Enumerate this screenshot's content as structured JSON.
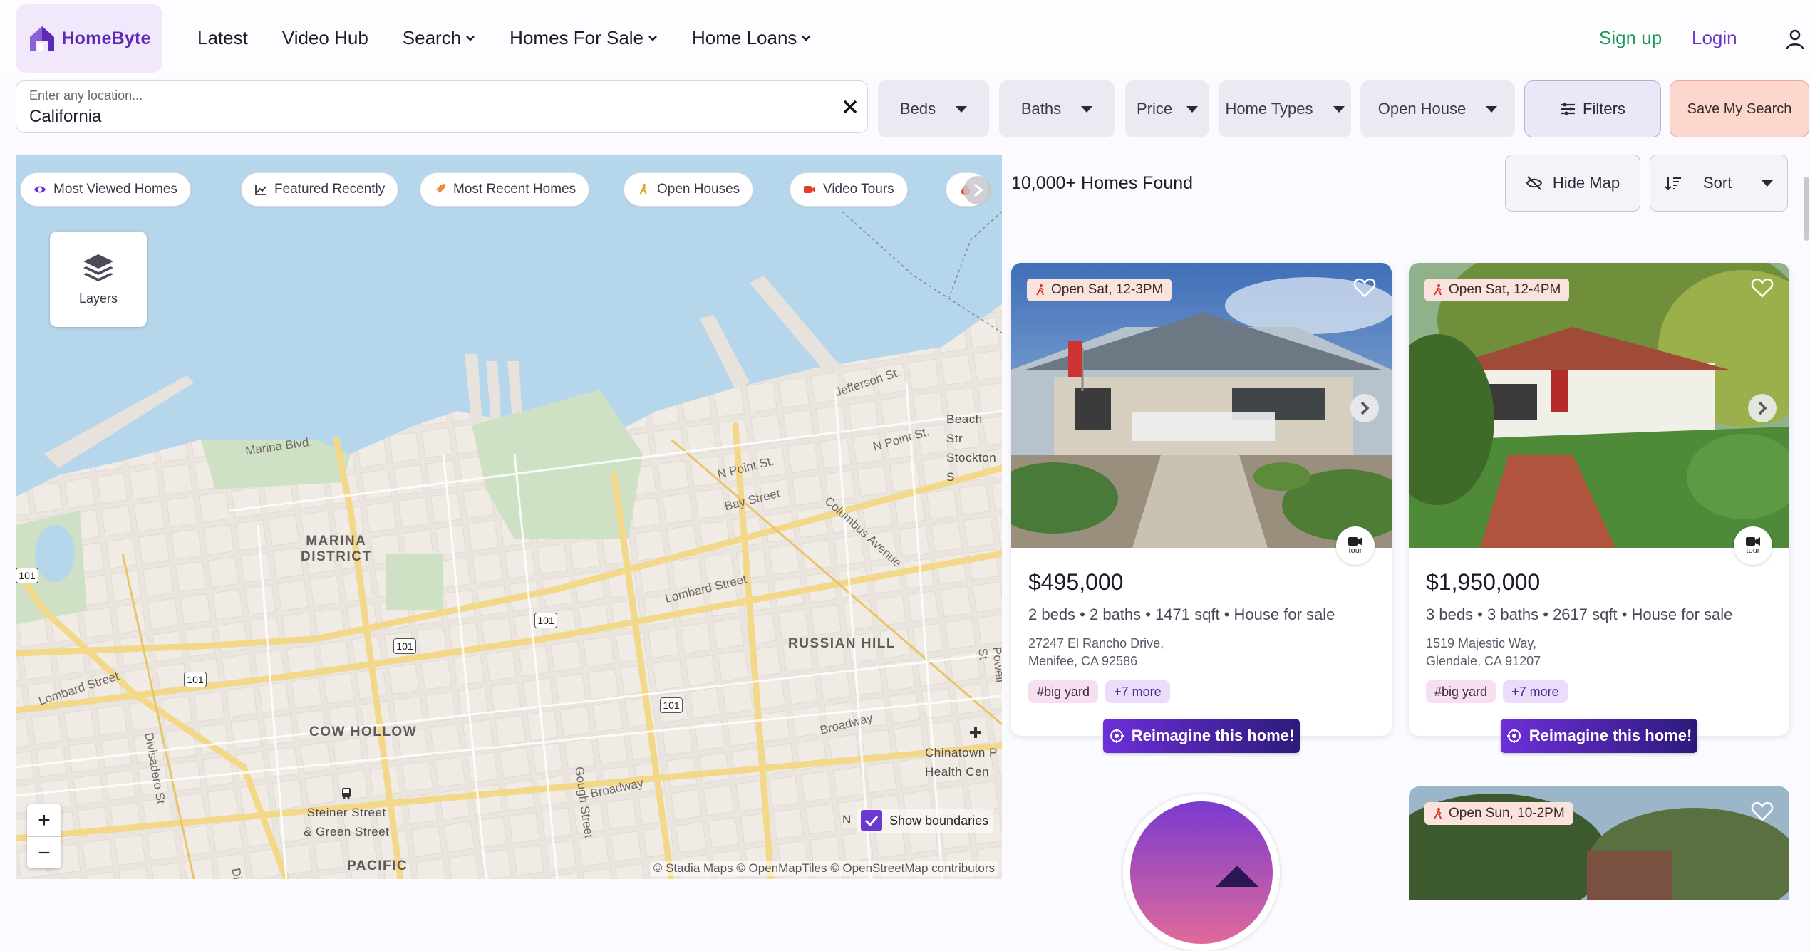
{
  "brand": {
    "name": "HomeByte"
  },
  "nav": {
    "latest": "Latest",
    "video_hub": "Video Hub",
    "search": "Search",
    "homes_for_sale": "Homes For Sale",
    "home_loans": "Home Loans",
    "signup": "Sign up",
    "login": "Login"
  },
  "search": {
    "placeholder": "Enter any location...",
    "value": "California"
  },
  "filters": {
    "beds": "Beds",
    "baths": "Baths",
    "price": "Price",
    "home_types": "Home Types",
    "open_house": "Open House",
    "filters": "Filters",
    "save_search": "Save My Search"
  },
  "map": {
    "chips": [
      "Most Viewed Homes",
      "Featured Recently",
      "Most Recent Homes",
      "Open Houses",
      "Video Tours"
    ],
    "layers_label": "Layers",
    "show_boundaries": "Show boundaries",
    "attribution": "© Stadia Maps © OpenMapTiles © OpenStreetMap contributors",
    "labels": {
      "marina_district": [
        "MARINA",
        "DISTRICT"
      ],
      "russian_hill": "RUSSIAN HILL",
      "cow_hollow": "COW HOLLOW",
      "pacific": "PACIFIC",
      "steiner": [
        "Steiner Street",
        "& Green Street"
      ],
      "chinatown": [
        "Chinatown P",
        "Health Cen"
      ],
      "beach": [
        "Beach Str",
        "Stockton S"
      ],
      "n_marker": "N"
    },
    "streets": {
      "marina_blvd": "Marina Blvd.",
      "jefferson": "Jefferson St.",
      "n_point_1": "N Point St.",
      "n_point_2": "N Point St.",
      "bay": "Bay Street",
      "columbus": "Columbus Avenue",
      "lombard_1": "Lombard Street",
      "lombard_2": "Lombard Street",
      "divisadero": "Divisadero St",
      "gough": "Gough Street",
      "broadway_1": "Broadway",
      "broadway_2": "Broadway",
      "powell": "Powell St",
      "divisa2": "Divisa"
    },
    "shield": "101"
  },
  "results": {
    "count": "10,000+ Homes Found",
    "hide_map": "Hide Map",
    "sort": "Sort"
  },
  "listings": [
    {
      "open": "Open Sat, 12-3PM",
      "price": "$495,000",
      "facts": "2 beds • 2 baths • 1471 sqft • House for sale",
      "addr1": "27247 El Rancho Drive,",
      "addr2": "Menifee, CA 92586",
      "tag1": "#big yard",
      "tag2": "+7 more",
      "tour": "tour",
      "reimagine": "Reimagine this home!"
    },
    {
      "open": "Open Sat, 12-4PM",
      "price": "$1,950,000",
      "facts": "3 beds • 3 baths • 2617 sqft • House for sale",
      "addr1": "1519 Majestic Way,",
      "addr2": "Glendale, CA 91207",
      "tag1": "#big yard",
      "tag2": "+7 more",
      "tour": "tour",
      "reimagine": "Reimagine this home!"
    },
    {
      "open": "Open Sun, 10-2PM"
    }
  ],
  "colors": {
    "brand_purple": "#5b2bb5",
    "signup_green": "#1e9a52",
    "login_purple": "#6a34c8",
    "save_search_bg": "#fbd7ce"
  }
}
